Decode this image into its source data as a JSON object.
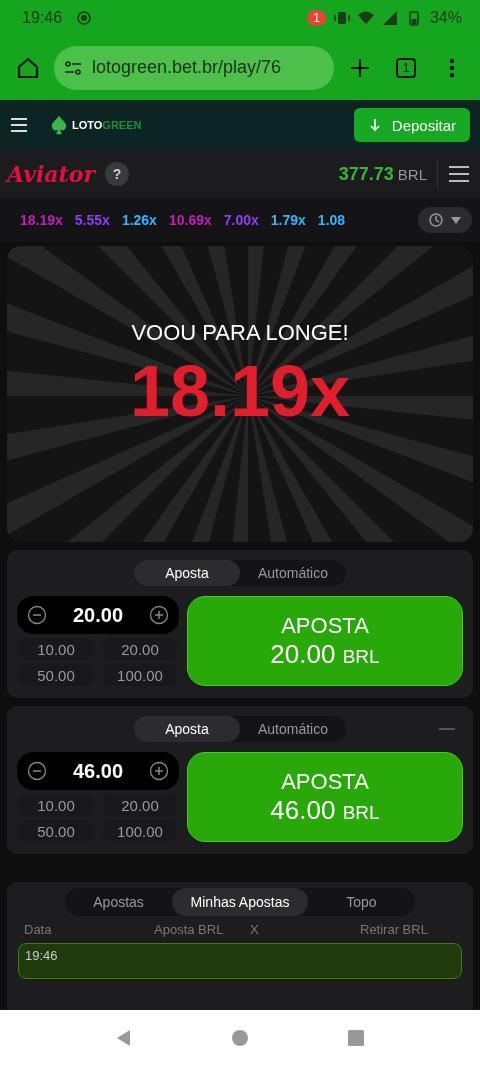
{
  "status_bar": {
    "time": "19:46",
    "notification_count": "1",
    "battery": "34%"
  },
  "browser": {
    "url": "lotogreen.bet.br/play/76",
    "tab_count": "1"
  },
  "site_header": {
    "logo_left": "LOTO",
    "logo_right": "GREEN",
    "deposit_button": "Depositar"
  },
  "game_header": {
    "title": "Aviator",
    "help": "?",
    "balance": "377.73",
    "currency": "BRL"
  },
  "multipliers": [
    {
      "value": "18.19x",
      "color": "#c21fb8"
    },
    {
      "value": "5.55x",
      "color": "#913ef8"
    },
    {
      "value": "1.26x",
      "color": "#34b4ff"
    },
    {
      "value": "10.69x",
      "color": "#c21fb8"
    },
    {
      "value": "7.00x",
      "color": "#913ef8"
    },
    {
      "value": "1.79x",
      "color": "#34b4ff"
    },
    {
      "value": "1.08",
      "color": "#34b4ff"
    }
  ],
  "game": {
    "message": "VOOU PARA LONGE!",
    "multiplier": "18.19x"
  },
  "bet_panels": [
    {
      "tabs": [
        {
          "label": "Aposta",
          "selected": true
        },
        {
          "label": "Automático",
          "selected": false
        }
      ],
      "removable": false,
      "amount": "20.00",
      "quick_amounts": [
        "10.00",
        "20.00",
        "50.00",
        "100.00"
      ],
      "button_label": "APOSTA",
      "button_amount": "20.00",
      "button_currency": "BRL"
    },
    {
      "tabs": [
        {
          "label": "Aposta",
          "selected": true
        },
        {
          "label": "Automático",
          "selected": false
        }
      ],
      "removable": true,
      "amount": "46.00",
      "quick_amounts": [
        "10.00",
        "20.00",
        "50.00",
        "100.00"
      ],
      "button_label": "APOSTA",
      "button_amount": "46.00",
      "button_currency": "BRL"
    }
  ],
  "history": {
    "tabs": [
      {
        "label": "Apostas",
        "selected": false
      },
      {
        "label": "Minhas Apostas",
        "selected": true
      },
      {
        "label": "Topo",
        "selected": false
      }
    ],
    "columns": [
      "Data",
      "Aposta BRL",
      "X",
      "Retirar BRL"
    ],
    "rows": [
      {
        "date": "19:46"
      }
    ]
  }
}
